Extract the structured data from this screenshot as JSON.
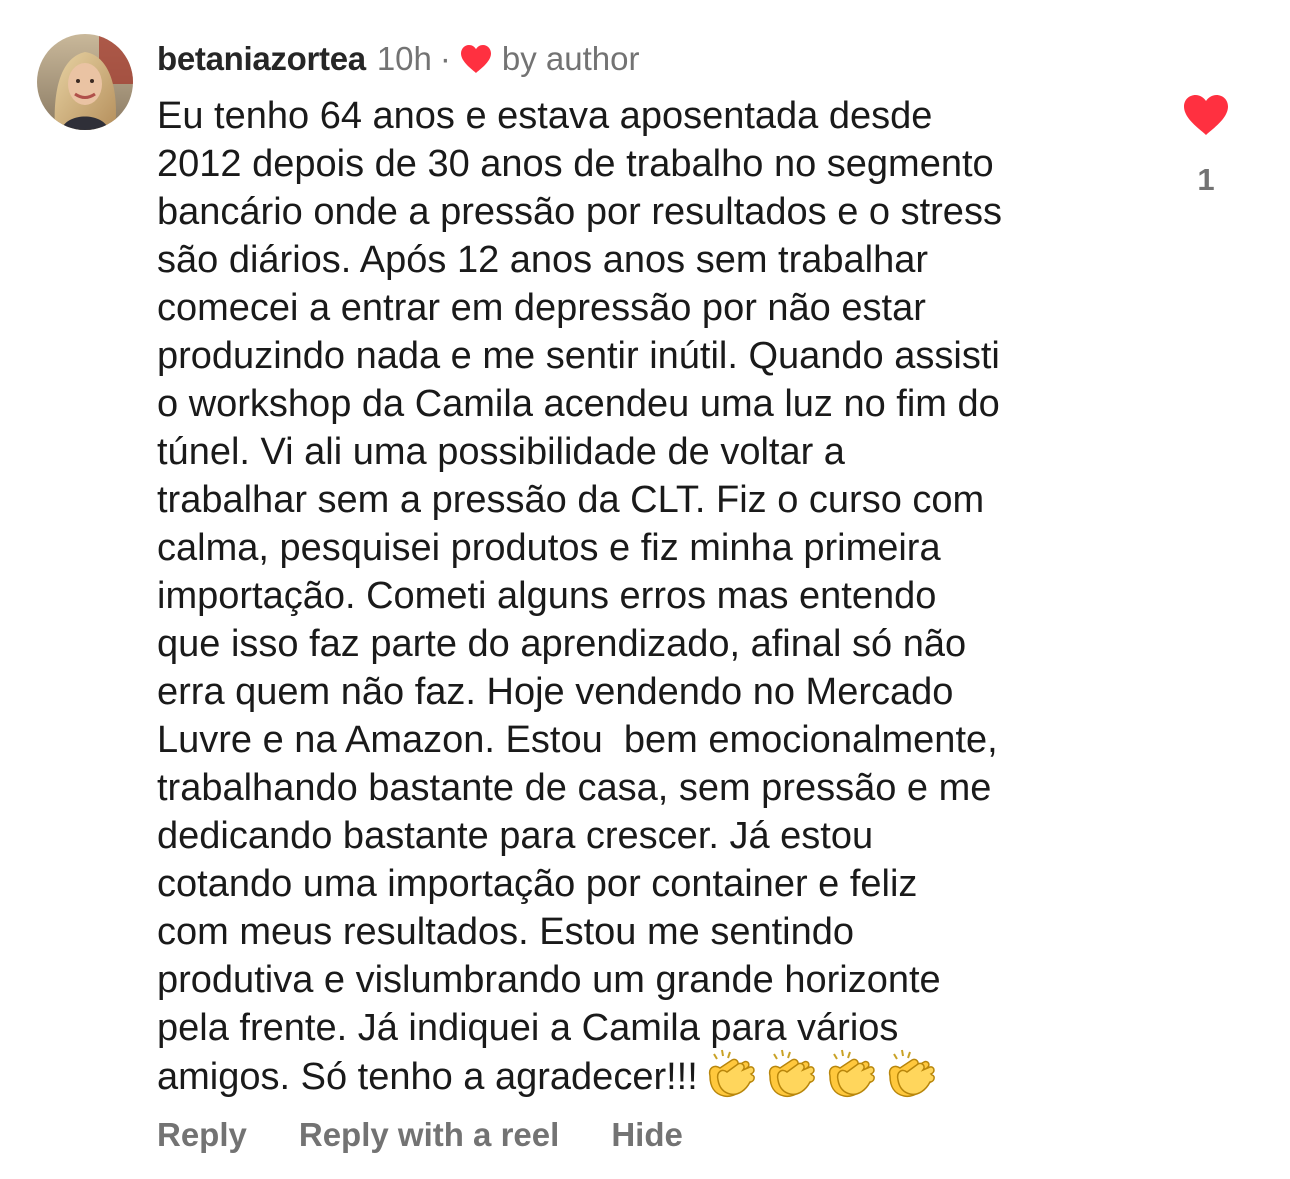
{
  "comment": {
    "username": "betaniazortea",
    "time": "10h",
    "separator": "·",
    "liked_by": "by author",
    "text_lines": [
      "Eu tenho 64 anos e estava aposentada desde",
      "2012 depois de 30 anos de trabalho no segmento",
      "bancário onde a pressão por resultados e o stress",
      "são diários. Após 12 anos anos sem trabalhar",
      "comecei a entrar em depressão por não estar",
      "produzindo nada e me sentir inútil. Quando assisti",
      "o workshop da Camila acendeu uma luz no fim do",
      "túnel. Vi ali uma possibilidade de voltar a",
      "trabalhar sem a pressão da CLT. Fiz o curso com",
      "calma, pesquisei produtos e fiz minha primeira",
      "importação. Cometi alguns erros mas entendo",
      "que isso faz parte do aprendizado, afinal só não",
      "erra quem não faz. Hoje vendendo no Mercado",
      "Luvre e na Amazon. Estou  bem emocionalmente,",
      "trabalhando bastante de casa, sem pressão e me",
      "dedicando bastante para crescer. Já estou",
      "cotando uma importação por container e feliz",
      "com meus resultados. Estou me sentindo",
      "produtiva e vislumbrando um grande horizonte",
      "pela frente. Já indiquei a Camila para vários",
      "amigos. Só tenho a agradecer!!!"
    ],
    "emoji": [
      "clapping-hands",
      "clapping-hands",
      "clapping-hands",
      "clapping-hands"
    ],
    "like_count": "1",
    "actions": {
      "reply": "Reply",
      "reply_reel": "Reply with a reel",
      "hide": "Hide"
    }
  },
  "colors": {
    "heart_red": "#ff3040",
    "muted_text": "#737373",
    "username": "#262626"
  },
  "icons": {
    "author_heart": "heart-icon",
    "like": "heart-icon",
    "avatar": "profile-photo"
  }
}
